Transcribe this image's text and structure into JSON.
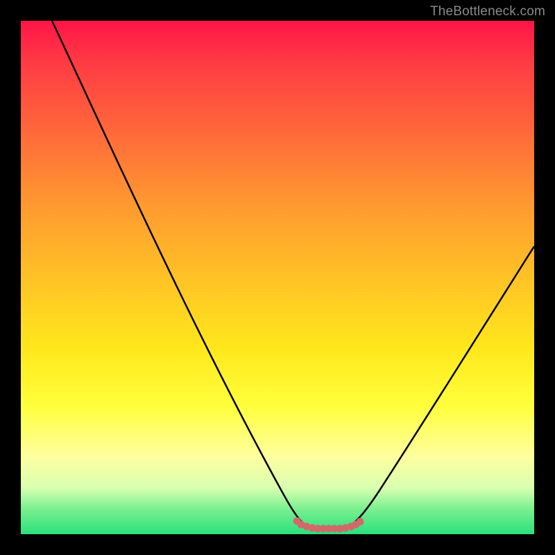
{
  "attribution": "TheBottleneck.com",
  "colors": {
    "background": "#000000",
    "gradient_top": "#ff1548",
    "gradient_bottom": "#2ae07c",
    "curve": "#000000",
    "marker": "#d06a6a"
  },
  "chart_data": {
    "type": "line",
    "title": "",
    "xlabel": "",
    "ylabel": "",
    "xlim": [
      0,
      100
    ],
    "ylim": [
      0,
      100
    ],
    "x": [
      0,
      5,
      10,
      15,
      20,
      25,
      30,
      35,
      40,
      45,
      50,
      52,
      54,
      56,
      58,
      60,
      62,
      64,
      66,
      70,
      75,
      80,
      85,
      90,
      95,
      100
    ],
    "values": [
      100,
      95,
      88,
      80,
      72,
      63,
      54,
      44,
      34,
      23,
      12,
      8,
      4,
      1,
      0,
      0,
      0,
      1,
      3,
      8,
      15,
      23,
      31,
      39,
      47,
      55
    ],
    "flat_region": {
      "x_start": 52,
      "x_end": 65,
      "y": 0
    }
  }
}
